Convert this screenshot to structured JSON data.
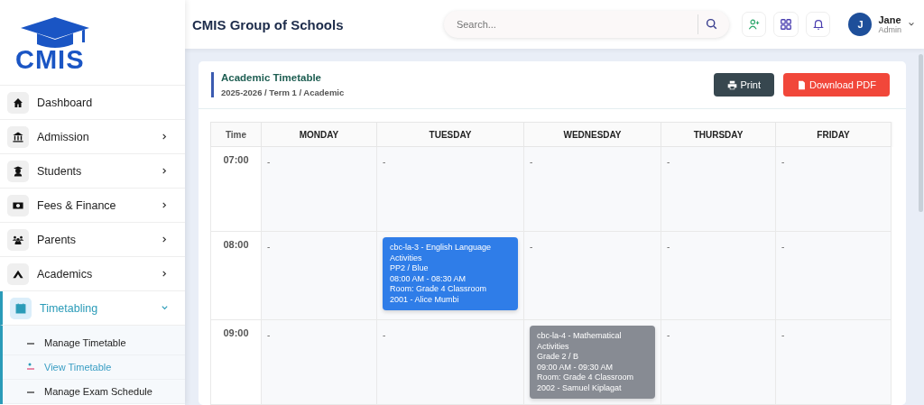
{
  "logo": {
    "text": "CMIS"
  },
  "sidebar": {
    "items": [
      {
        "label": "Dashboard",
        "selected": false
      },
      {
        "label": "Admission",
        "expanded": false,
        "selected": false
      },
      {
        "label": "Students",
        "expanded": false,
        "selected": false
      },
      {
        "label": "Fees & Finance",
        "expanded": false,
        "selected": false
      },
      {
        "label": "Parents",
        "expanded": false,
        "selected": false
      },
      {
        "label": "Academics",
        "expanded": false,
        "selected": false
      },
      {
        "label": "Timetabling",
        "expanded": true,
        "selected": true,
        "children": [
          {
            "label": "Manage Timetable",
            "selected": false
          },
          {
            "label": "View Timetable",
            "selected": true
          },
          {
            "label": "Manage Exam Schedule",
            "selected": false
          }
        ]
      }
    ]
  },
  "header": {
    "title": "CMIS Group of Schools",
    "search": {
      "placeholder": "Search..."
    },
    "user": {
      "initial": "J",
      "name": "Jane",
      "role": "Admin"
    }
  },
  "card": {
    "title": "Academic Timetable",
    "subtitle": "2025-2026 / Term 1 / Academic",
    "buttons": [
      {
        "kind": "print",
        "label": "Print"
      },
      {
        "kind": "pdf",
        "label": "Download PDF"
      }
    ]
  },
  "timetable": {
    "columns": [
      "Time",
      "MONDAY",
      "TUESDAY",
      "WEDNESDAY",
      "THURSDAY",
      "FRIDAY"
    ],
    "rows": [
      {
        "time": "07:00",
        "cells": [
          {
            "kind": "empty",
            "text": "-"
          },
          {
            "kind": "empty",
            "text": "-"
          },
          {
            "kind": "empty",
            "text": "-"
          },
          {
            "kind": "empty",
            "text": "-"
          },
          {
            "kind": "empty",
            "text": "-"
          }
        ]
      },
      {
        "time": "08:00",
        "cells": [
          {
            "kind": "empty",
            "text": "-"
          },
          {
            "kind": "lesson",
            "color": "#2f7de8",
            "title": "cbc-la-3 - English Language Activities",
            "group": "PP2 / Blue",
            "period": "08:00 AM - 08:30 AM",
            "room": "Room: Grade 4 Classroom",
            "teacher": "2001 - Alice Mumbi"
          },
          {
            "kind": "empty",
            "text": "-"
          },
          {
            "kind": "empty",
            "text": "-"
          },
          {
            "kind": "empty",
            "text": "-"
          }
        ]
      },
      {
        "time": "09:00",
        "cells": [
          {
            "kind": "empty",
            "text": "-"
          },
          {
            "kind": "empty",
            "text": "-"
          },
          {
            "kind": "lesson",
            "color": "#878b93",
            "title": "cbc-la-4 - Mathematical Activities",
            "group": "Grade 2 / B",
            "period": "09:00 AM - 09:30 AM",
            "room": "Room: Grade 4 Classroom",
            "teacher": "2002 - Samuel Kiplagat"
          },
          {
            "kind": "empty",
            "text": "-"
          },
          {
            "kind": "empty",
            "text": "-"
          }
        ]
      }
    ]
  }
}
